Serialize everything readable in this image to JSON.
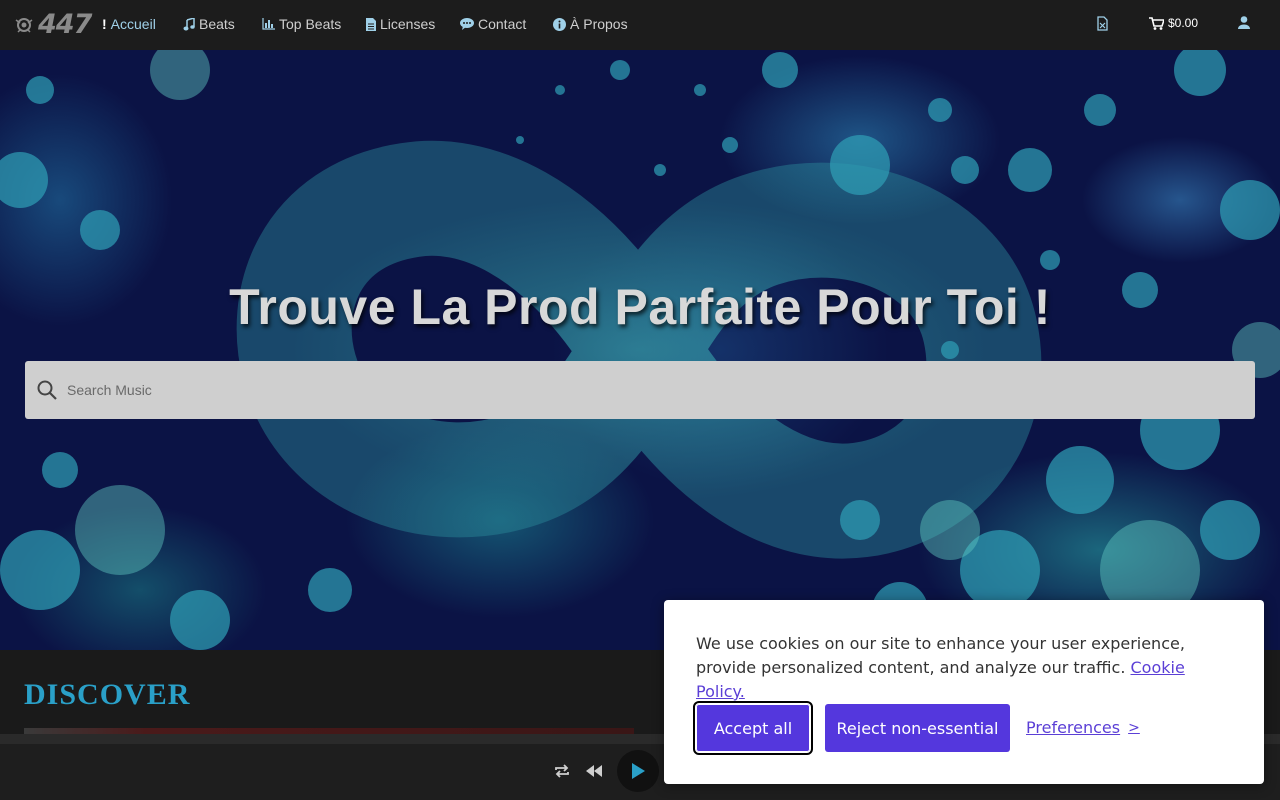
{
  "nav": {
    "logo_text": "447",
    "items": [
      {
        "label": "Accueil",
        "icon": "exclamation-icon",
        "active": true
      },
      {
        "label": "Beats",
        "icon": "music-note-icon"
      },
      {
        "label": "Top Beats",
        "icon": "bar-chart-icon"
      },
      {
        "label": "Licenses",
        "icon": "document-icon"
      },
      {
        "label": "Contact",
        "icon": "chat-bubble-icon"
      },
      {
        "label": "À Propos",
        "icon": "info-icon"
      }
    ],
    "cart_total": "$0.00",
    "right_icons": [
      "download-file-icon",
      "cart-icon",
      "user-icon"
    ]
  },
  "hero": {
    "title": "Trouve La Prod Parfaite Pour Toi !",
    "search_placeholder": "Search Music"
  },
  "discover": {
    "title": "DISCOVER"
  },
  "player": {
    "controls": [
      "repeat-icon",
      "previous-icon",
      "play-icon"
    ]
  },
  "cookie": {
    "message": "We use cookies on our site to enhance your user experience, provide personalized content, and analyze our traffic.",
    "policy_link": "Cookie Policy.",
    "accept_label": "Accept all",
    "reject_label": "Reject non-essential",
    "preferences_label": "Preferences",
    "preferences_chevron": ">"
  },
  "colors": {
    "accent": "#5437dd",
    "discover_title": "#2aa0c8",
    "hero_bg": "#0b1345",
    "nav_active": "#9fd0e8"
  }
}
